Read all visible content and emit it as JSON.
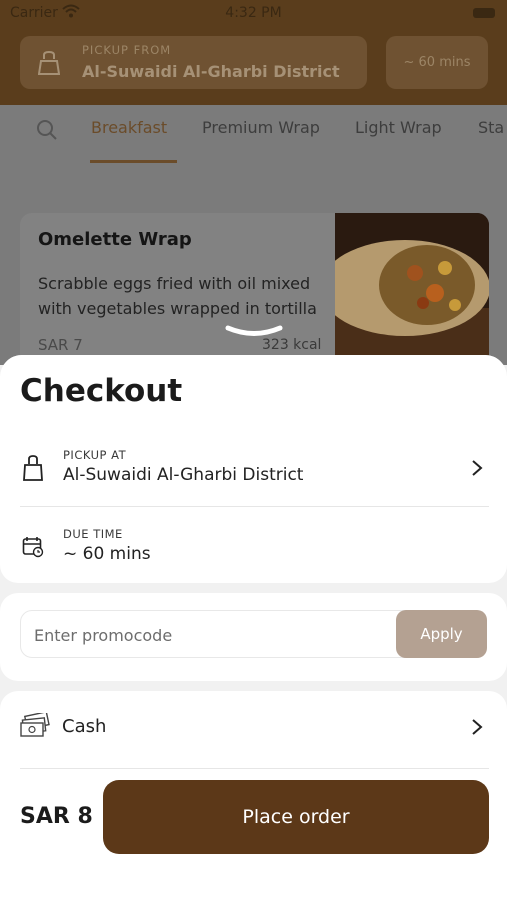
{
  "status_bar": {
    "carrier": "Carrier",
    "time": "4:32 PM"
  },
  "header": {
    "pickup_label": "PICKUP FROM",
    "pickup_value": "Al-Suwaidi Al-Gharbi District",
    "time_value": "~ 60 mins"
  },
  "tabs": [
    {
      "label": "Breakfast",
      "active": true
    },
    {
      "label": "Premium Wrap",
      "active": false
    },
    {
      "label": "Light Wrap",
      "active": false
    },
    {
      "label": "Sta",
      "active": false
    }
  ],
  "menu_item": {
    "title": "Omelette Wrap",
    "description": "Scrabble eggs fried with oil mixed with vegetables wrapped in tortilla",
    "price": "SAR 7",
    "calories": "323 kcal"
  },
  "checkout": {
    "title": "Checkout",
    "pickup_label": "PICKUP AT",
    "pickup_value": "Al-Suwaidi Al-Gharbi District",
    "due_label": "DUE TIME",
    "due_value": "~ 60 mins",
    "promo_placeholder": "Enter promocode",
    "apply_label": "Apply",
    "payment_method": "Cash",
    "total": "SAR 8",
    "place_order_label": "Place order"
  },
  "icons": {
    "status": [
      "wifi-icon",
      "battery-icon"
    ],
    "header": [
      "shopping-bag-icon"
    ],
    "tabs": [
      "search-icon"
    ],
    "checkout": [
      "shopping-bag-icon",
      "calendar-clock-icon",
      "cash-icon",
      "chevron-right-icon",
      "sheet-handle-icon"
    ]
  },
  "colors": {
    "brand_brown": "#5c3818",
    "apply_button": "#b4a192",
    "active_tab": "#6b4c2a"
  }
}
